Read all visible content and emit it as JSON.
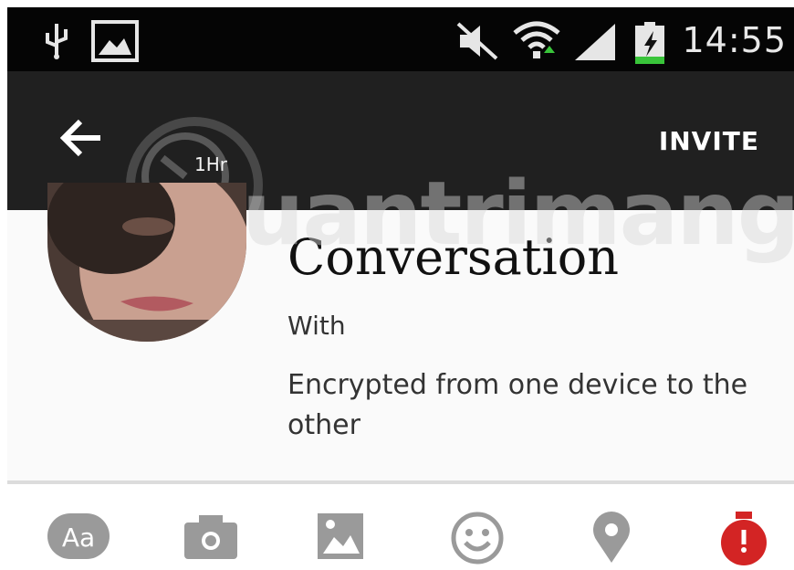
{
  "status_bar": {
    "time": "14:55",
    "icons": [
      "usb-icon",
      "image-notification-icon",
      "mute-icon",
      "wifi-icon",
      "signal-icon",
      "battery-charging-icon"
    ]
  },
  "app_bar": {
    "back_icon": "back-arrow-icon",
    "timer_label": "1Hr",
    "invite_label": "INVITE"
  },
  "conversation": {
    "title": "Conversation",
    "with_label": "With",
    "encryption_note": "Encrypted from one device to the other"
  },
  "watermark": {
    "text": "uantrimang"
  },
  "toolbar": {
    "items": [
      {
        "icon": "text-format-icon",
        "label": "Aa"
      },
      {
        "icon": "camera-icon"
      },
      {
        "icon": "gallery-icon"
      },
      {
        "icon": "emoji-icon"
      },
      {
        "icon": "location-pin-icon"
      },
      {
        "icon": "timer-icon"
      }
    ]
  },
  "colors": {
    "status_bar": "#050505",
    "app_bar": "#202020",
    "toolbar_icon": "#9a9a9a",
    "timer_accent": "#d32424",
    "battery_accent": "#39c43a"
  }
}
